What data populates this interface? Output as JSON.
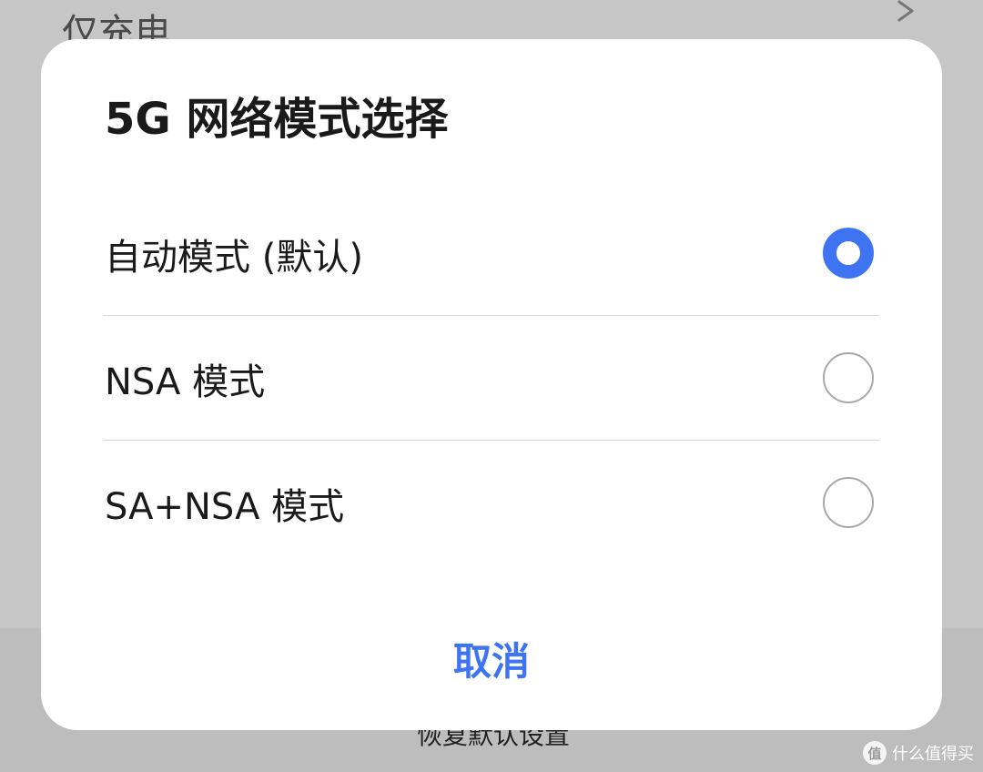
{
  "background": {
    "top_item_label": "仅充电",
    "reset_label": "恢复默认设置"
  },
  "dialog": {
    "title": "5G 网络模式选择",
    "options": [
      {
        "label": "自动模式 (默认)",
        "selected": true
      },
      {
        "label": "NSA 模式",
        "selected": false
      },
      {
        "label": "SA+NSA 模式",
        "selected": false
      }
    ],
    "cancel_label": "取消"
  },
  "watermark": {
    "badge": "值",
    "text": "什么值得买"
  },
  "colors": {
    "accent": "#3e74f2",
    "overlay": "#c6c6c6"
  },
  "icons": {
    "background_chevron": "chevron-right-icon",
    "radio_selected": "radio-checked-icon",
    "radio_unselected": "radio-unchecked-icon"
  }
}
